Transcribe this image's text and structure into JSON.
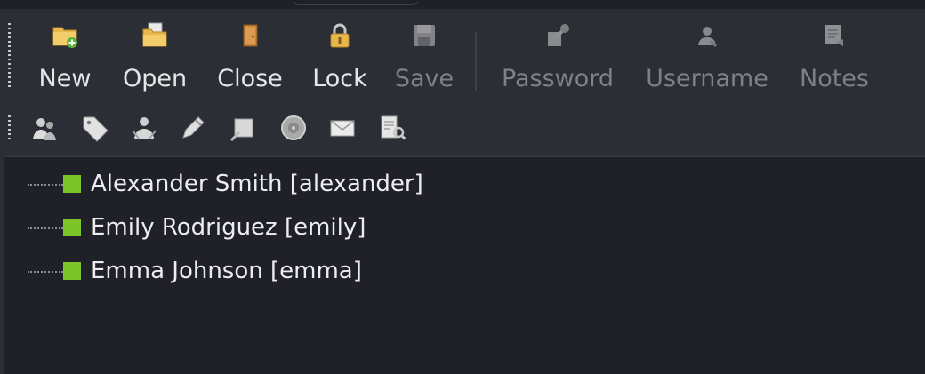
{
  "toolbar": {
    "buttons": [
      {
        "label": "New",
        "icon": "new-folder-icon",
        "enabled": true
      },
      {
        "label": "Open",
        "icon": "open-folder-icon",
        "enabled": true
      },
      {
        "label": "Close",
        "icon": "door-icon",
        "enabled": true
      },
      {
        "label": "Lock",
        "icon": "lock-icon",
        "enabled": true
      },
      {
        "label": "Save",
        "icon": "save-icon",
        "enabled": false
      },
      {
        "label": "Password",
        "icon": "key-icon",
        "enabled": false
      },
      {
        "label": "Username",
        "icon": "user-icon",
        "enabled": false
      },
      {
        "label": "Notes",
        "icon": "notes-icon",
        "enabled": false
      }
    ]
  },
  "entry_toolbar": {
    "icons": [
      "users-icon",
      "tag-icon",
      "user-group-icon",
      "key-edit-icon",
      "copy-icon",
      "disc-icon",
      "email-icon",
      "search-doc-icon"
    ]
  },
  "tree": {
    "entries": [
      {
        "label": "Alexander Smith [alexander]"
      },
      {
        "label": "Emily Rodriguez [emily]"
      },
      {
        "label": "Emma Johnson [emma]"
      }
    ]
  },
  "colors": {
    "background": "#2c2e35",
    "tree_background": "#1f2028",
    "entry_marker": "#7dc42a",
    "folder_yellow": "#e8b84a"
  }
}
